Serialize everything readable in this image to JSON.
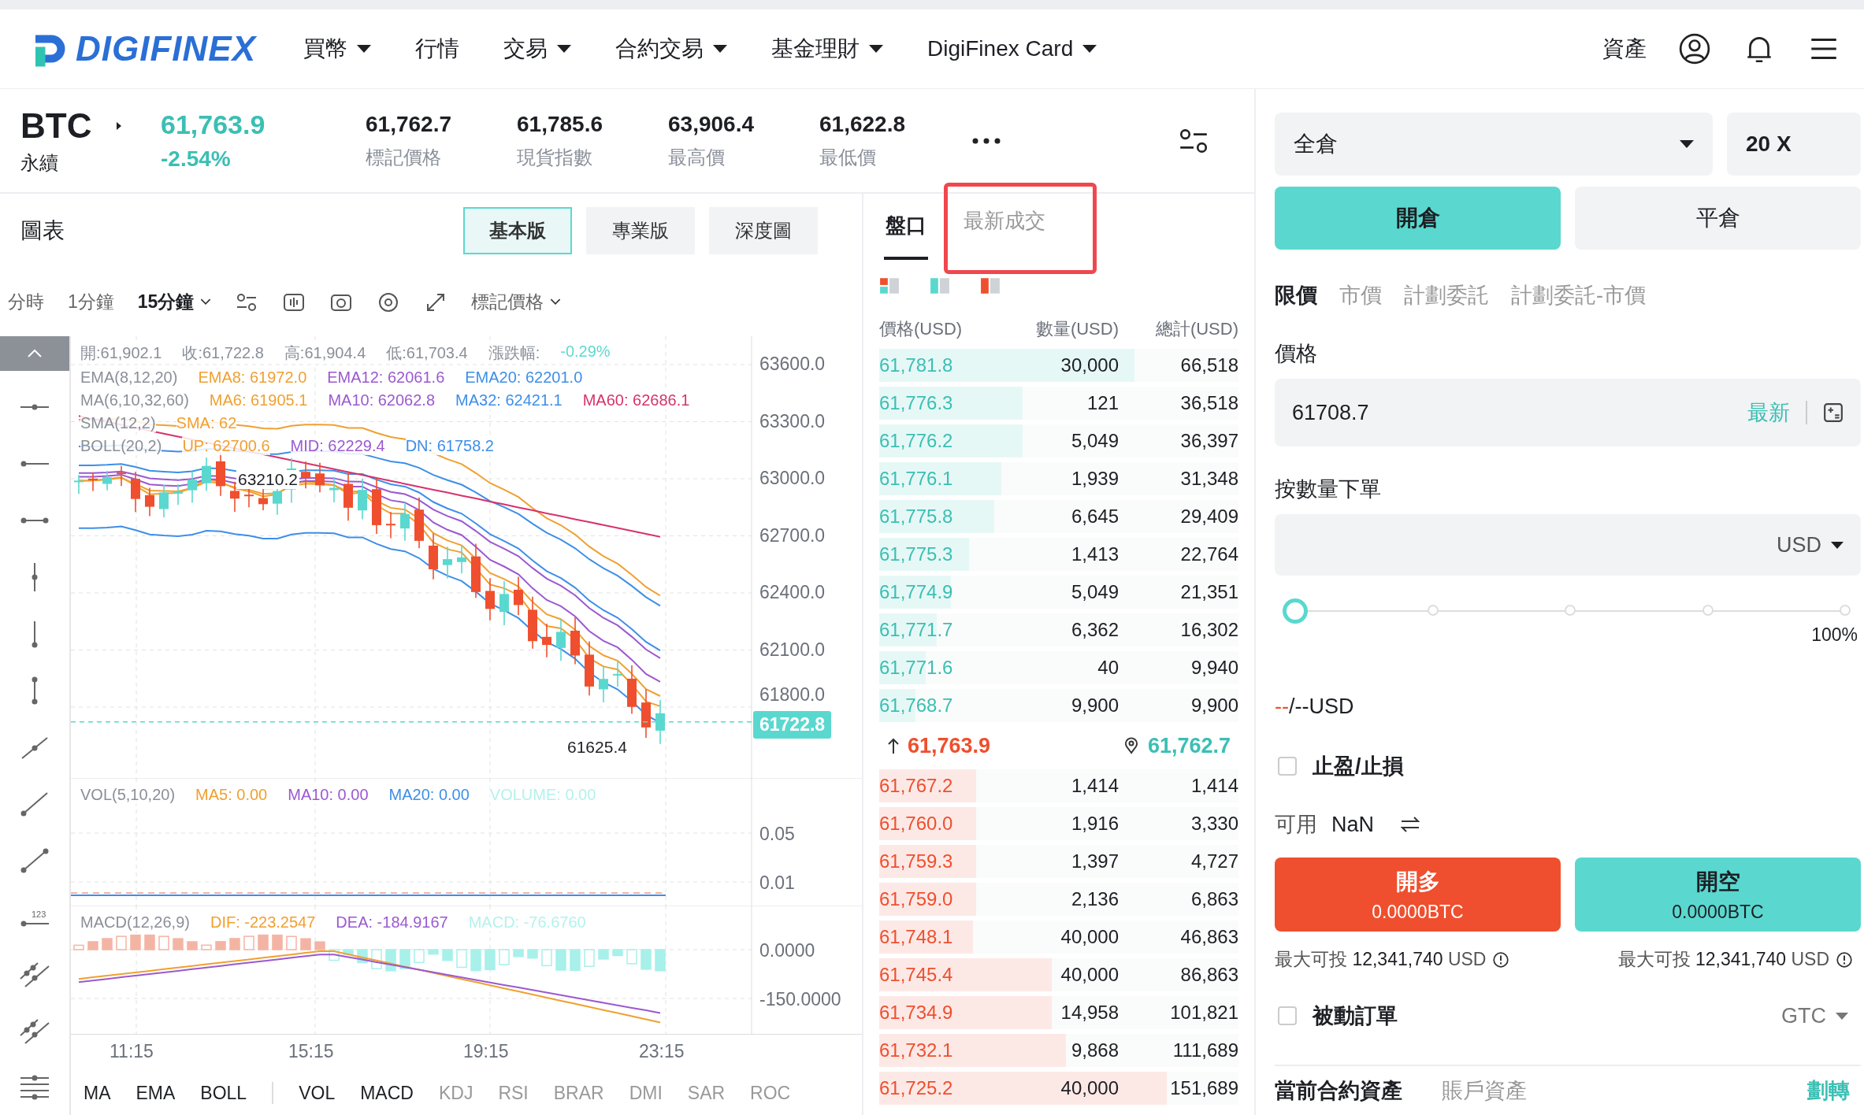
{
  "nav": {
    "logo": "DIGIFINEX",
    "menu": [
      {
        "label": "買幣",
        "dropdown": true
      },
      {
        "label": "行情",
        "dropdown": false
      },
      {
        "label": "交易",
        "dropdown": true
      },
      {
        "label": "合約交易",
        "dropdown": true
      },
      {
        "label": "基金理財",
        "dropdown": true
      },
      {
        "label": "DigiFinex Card",
        "dropdown": true
      }
    ],
    "assets": "資產"
  },
  "ticker": {
    "symbol": "BTC",
    "contract": "永續",
    "price": "61,763.9",
    "change": "-2.54%",
    "stats": [
      {
        "value": "61,762.7",
        "label": "標記價格"
      },
      {
        "value": "61,785.6",
        "label": "現貨指數"
      },
      {
        "value": "63,906.4",
        "label": "最高價"
      },
      {
        "value": "61,622.8",
        "label": "最低價"
      }
    ]
  },
  "chart": {
    "title": "圖表",
    "views": [
      {
        "label": "基本版",
        "selected": true
      },
      {
        "label": "專業版",
        "selected": false
      },
      {
        "label": "深度圖",
        "selected": false
      }
    ],
    "intervals": [
      {
        "label": "分時",
        "selected": false,
        "dropdown": false
      },
      {
        "label": "1分鐘",
        "selected": false,
        "dropdown": false
      },
      {
        "label": "15分鐘",
        "selected": true,
        "dropdown": true
      }
    ],
    "price_type": "標記價格",
    "drawing_tools": [
      {
        "kind": "collapse",
        "selected": true
      },
      {
        "kind": "hline",
        "selected": false
      },
      {
        "kind": "hray",
        "selected": false
      },
      {
        "kind": "hsegment",
        "selected": false
      },
      {
        "kind": "vline",
        "selected": false
      },
      {
        "kind": "vray",
        "selected": false
      },
      {
        "kind": "vsegment",
        "selected": false
      },
      {
        "kind": "line",
        "selected": false
      },
      {
        "kind": "ray",
        "selected": false
      },
      {
        "kind": "segment",
        "selected": false
      },
      {
        "kind": "price-label",
        "text": "123",
        "selected": false
      },
      {
        "kind": "channel",
        "selected": false
      },
      {
        "kind": "channel",
        "selected": false
      },
      {
        "kind": "fib",
        "selected": false
      }
    ],
    "main_legend": [
      [
        {
          "text": "開:61,902.1",
          "color": "#8a8f99"
        },
        {
          "text": "收:61,722.8",
          "color": "#8a8f99"
        },
        {
          "text": "高:61,904.4",
          "color": "#8a8f99"
        },
        {
          "text": "低:61,703.4",
          "color": "#8a8f99"
        },
        {
          "text": "漲跌幅:",
          "color": "#8a8f99"
        },
        {
          "text": "-0.29%",
          "color": "#5fd9cf"
        }
      ],
      [
        {
          "text": "EMA(8,12,20)",
          "color": "#8a8f99"
        },
        {
          "text": "EMA8: 61972.0",
          "color": "#f0a030"
        },
        {
          "text": "EMA12: 62061.6",
          "color": "#9b59d0"
        },
        {
          "text": "EMA20: 62201.0",
          "color": "#3d8fe8"
        }
      ],
      [
        {
          "text": "MA(6,10,32,60)",
          "color": "#8a8f99"
        },
        {
          "text": "MA6: 61905.1",
          "color": "#f0a030"
        },
        {
          "text": "MA10: 62062.8",
          "color": "#9b59d0"
        },
        {
          "text": "MA32: 62421.1",
          "color": "#3d8fe8"
        },
        {
          "text": "MA60: 62686.1",
          "color": "#d6336c"
        }
      ],
      [
        {
          "text": "SMA(12,2)",
          "color": "#8a8f99"
        },
        {
          "text": "SMA: 62",
          "color": "#f0a030"
        }
      ],
      [
        {
          "text": "BOLL(20,2)",
          "color": "#8a8f99"
        },
        {
          "text": "UP: 62700.6",
          "color": "#f0a030"
        },
        {
          "text": "MID: 62229.4",
          "color": "#9b59d0"
        },
        {
          "text": "DN: 61758.2",
          "color": "#3d8fe8"
        }
      ]
    ],
    "price_axis": [
      "63600.0",
      "63300.0",
      "63000.0",
      "62700.0",
      "62400.0",
      "62100.0",
      "61800.0"
    ],
    "current_price": "61722.8",
    "high_mark": "63210.2",
    "low_mark": "61625.4",
    "vol_legend": [
      {
        "text": "VOL(5,10,20)",
        "color": "#8a8f99"
      },
      {
        "text": "MA5: 0.00",
        "color": "#f0a030"
      },
      {
        "text": "MA10: 0.00",
        "color": "#9b59d0"
      },
      {
        "text": "MA20: 0.00",
        "color": "#3d8fe8"
      },
      {
        "text": "VOLUME: 0.00",
        "color": "#b4f2ec"
      }
    ],
    "vol_axis": [
      "0.05",
      "0.01"
    ],
    "macd_legend": [
      {
        "text": "MACD(12,26,9)",
        "color": "#8a8f99"
      },
      {
        "text": "DIF: -223.2547",
        "color": "#f0a030"
      },
      {
        "text": "DEA: -184.9167",
        "color": "#9b59d0"
      },
      {
        "text": "MACD: -76.6760",
        "color": "#b4f2ec"
      }
    ],
    "macd_axis": [
      "0.0000",
      "-150.0000"
    ],
    "time_axis": [
      "11:15",
      "15:15",
      "19:15",
      "23:15"
    ],
    "main_indicators": [
      {
        "label": "MA",
        "selected": true
      },
      {
        "label": "EMA",
        "selected": true
      },
      {
        "label": "BOLL",
        "selected": true
      }
    ],
    "sub_indicators": [
      {
        "label": "VOL",
        "selected": true
      },
      {
        "label": "MACD",
        "selected": true
      },
      {
        "label": "KDJ",
        "selected": false
      },
      {
        "label": "RSI",
        "selected": false
      },
      {
        "label": "BRAR",
        "selected": false
      },
      {
        "label": "DMI",
        "selected": false
      },
      {
        "label": "SAR",
        "selected": false
      },
      {
        "label": "ROC",
        "selected": false
      }
    ]
  },
  "order_book": {
    "tabs": [
      {
        "label": "盤口",
        "selected": true,
        "highlighted": false
      },
      {
        "label": "最新成交",
        "selected": false,
        "highlighted": true
      }
    ],
    "columns": [
      "價格(USD)",
      "數量(USD)",
      "總計(USD)"
    ],
    "asks": [
      {
        "price": "61,781.8",
        "amount": "30,000",
        "total": "66,518",
        "level": 0.71
      },
      {
        "price": "61,776.3",
        "amount": "121",
        "total": "36,518",
        "level": 0.4
      },
      {
        "price": "61,776.2",
        "amount": "5,049",
        "total": "36,397",
        "level": 0.4
      },
      {
        "price": "61,776.1",
        "amount": "1,939",
        "total": "31,348",
        "level": 0.34
      },
      {
        "price": "61,775.8",
        "amount": "6,645",
        "total": "29,409",
        "level": 0.32
      },
      {
        "price": "61,775.3",
        "amount": "1,413",
        "total": "22,764",
        "level": 0.25
      },
      {
        "price": "61,774.9",
        "amount": "5,049",
        "total": "21,351",
        "level": 0.2
      },
      {
        "price": "61,771.7",
        "amount": "6,362",
        "total": "16,302",
        "level": 0.16
      },
      {
        "price": "61,771.6",
        "amount": "40",
        "total": "9,940",
        "level": 0.13
      },
      {
        "price": "61,768.7",
        "amount": "9,900",
        "total": "9,900",
        "level": 0.1
      }
    ],
    "last_price": "61,763.9",
    "mark_price": "61,762.7",
    "bids": [
      {
        "price": "61,767.2",
        "amount": "1,414",
        "total": "1,414",
        "level": 0.27
      },
      {
        "price": "61,760.0",
        "amount": "1,916",
        "total": "3,330",
        "level": 0.27
      },
      {
        "price": "61,759.3",
        "amount": "1,397",
        "total": "4,727",
        "level": 0.27
      },
      {
        "price": "61,759.0",
        "amount": "2,136",
        "total": "6,863",
        "level": 0.27
      },
      {
        "price": "61,748.1",
        "amount": "40,000",
        "total": "46,863",
        "level": 0.26
      },
      {
        "price": "61,745.4",
        "amount": "40,000",
        "total": "86,863",
        "level": 0.48
      },
      {
        "price": "61,734.9",
        "amount": "14,958",
        "total": "101,821",
        "level": 0.48
      },
      {
        "price": "61,732.1",
        "amount": "9,868",
        "total": "111,689",
        "level": 0.52
      },
      {
        "price": "61,725.2",
        "amount": "40,000",
        "total": "151,689",
        "level": 0.8
      }
    ]
  },
  "trade": {
    "margin_mode": "全倉",
    "leverage": "20 X",
    "position_tabs": [
      {
        "label": "開倉",
        "selected": true
      },
      {
        "label": "平倉",
        "selected": false
      }
    ],
    "order_types": [
      {
        "label": "限價",
        "selected": true
      },
      {
        "label": "市價",
        "selected": false
      },
      {
        "label": "計劃委託",
        "selected": false
      },
      {
        "label": "計劃委託-市價",
        "selected": false
      }
    ],
    "price_label": "價格",
    "price_value": "61708.7",
    "latest_link": "最新",
    "qty_label": "按數量下單",
    "qty_unit": "USD",
    "slider": {
      "level": 0,
      "max_label": "100%"
    },
    "estimate_prefix": "--",
    "estimate_rest": "/--USD",
    "tp_sl": {
      "label": "止盈/止損",
      "checked": false
    },
    "available_label": "可用",
    "available_value": "NaN",
    "buy": {
      "label": "開多",
      "amount": "0.0000BTC"
    },
    "sell": {
      "label": "開空",
      "amount": "0.0000BTC"
    },
    "max_buy": {
      "label": "最大可投",
      "value": "12,341,740",
      "unit": "USD"
    },
    "max_sell": {
      "label": "最大可投",
      "value": "12,341,740",
      "unit": "USD"
    },
    "post_only": {
      "label": "被動訂單",
      "checked": false
    },
    "tif": "GTC",
    "bottom_tabs": [
      {
        "label": "當前合約資產",
        "selected": true
      },
      {
        "label": "賬戶資產",
        "selected": false
      }
    ],
    "transfer": "劃轉"
  }
}
